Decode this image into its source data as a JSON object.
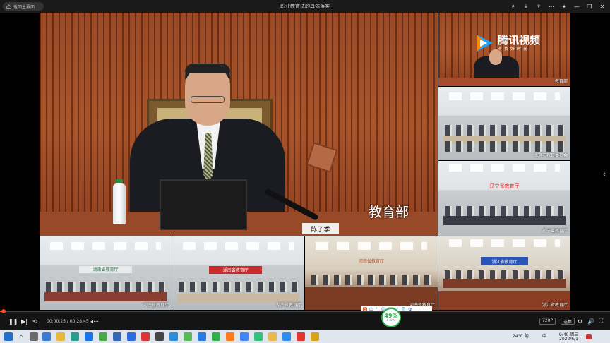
{
  "titlebar": {
    "back_label": "返回主界面",
    "title": "职业教育法的具体落实",
    "icons": [
      "search-icon",
      "download-icon",
      "share-icon",
      "more-icon",
      "pin-icon",
      "minimize-icon",
      "restore-icon",
      "close-icon"
    ]
  },
  "main_video": {
    "location_label": "教育部",
    "nameplate": "陈子季"
  },
  "logo": {
    "title": "腾讯视频",
    "subtitle": "不负好时光"
  },
  "side_videos": [
    {
      "label": "教育部"
    },
    {
      "label": "北京市教育委员会"
    },
    {
      "label": "辽宁省教育厅",
      "banner": "辽宁省教育厅"
    },
    {
      "label": "浙江省教育厅",
      "banner": "浙江省教育厅"
    }
  ],
  "bottom_videos": [
    {
      "label": "河南省教育厅",
      "banner": "湖南省教育厅"
    },
    {
      "label": "湖南省教育厅",
      "banner": "湖南省教育厅"
    },
    {
      "label": "河南省教育厅",
      "banner": "河南省教育厅"
    }
  ],
  "player": {
    "time": "00:00:25 / 00:28:45",
    "quality": "720P",
    "select_label": "选集",
    "progress_fraction": 0.005
  },
  "speed_widget": {
    "value": "49%",
    "sub": "0.5K/s"
  },
  "ime": {
    "items": [
      "S",
      "中",
      "°,",
      "☺",
      "⌨",
      "♪",
      "👕",
      "✿"
    ]
  },
  "taskbar": {
    "weather": "24°C 阴",
    "ime_indicator": "中",
    "time": "9:40 周三",
    "date": "2022/6/1"
  },
  "colors": {
    "accent": "#ff4a2a",
    "wood": "#a9552b",
    "speed_green": "#28b34a"
  }
}
